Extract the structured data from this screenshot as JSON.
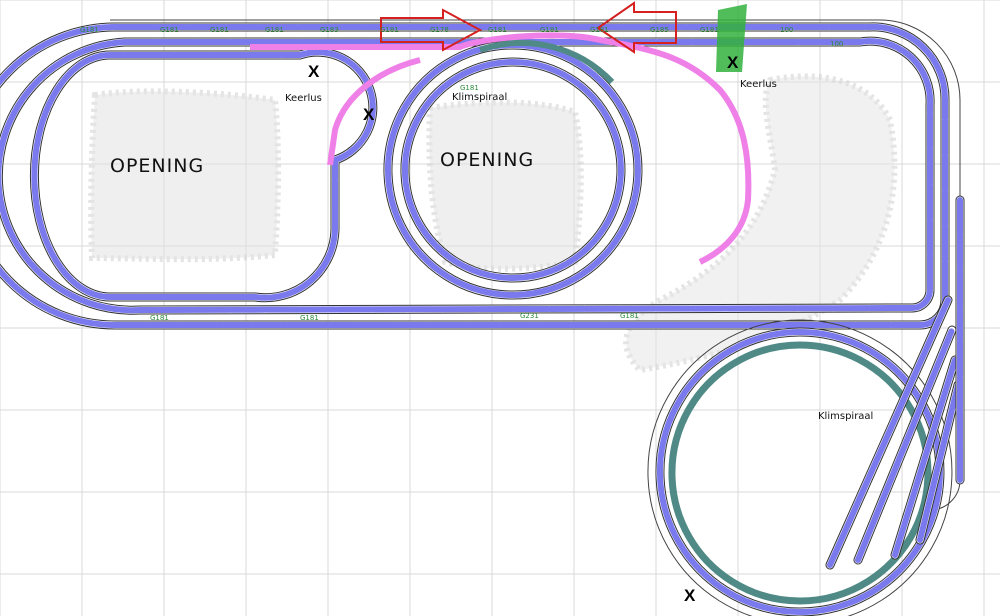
{
  "areas": {
    "opening_left": "OPENING",
    "opening_center": "OPENING",
    "keerlus_left": "Keerlus",
    "keerlus_right": "Keerlus",
    "klimspiraal_top": "Klimspiraal",
    "klimspiraal_right": "Klimspiraal"
  },
  "markers": {
    "x1": "X",
    "x2": "X",
    "x3": "X",
    "x4": "X"
  },
  "track_codes": [
    "G181",
    "G181",
    "G181",
    "G181",
    "G183",
    "G181",
    "G178",
    "G181",
    "G181",
    "G181",
    "G185",
    "G181",
    "G181",
    "G181",
    "G231",
    "G181",
    "G181",
    "100",
    "100"
  ],
  "colors": {
    "track": "#7a7aee",
    "track_edge": "#3b3bb0",
    "highlight": "#ef80e8",
    "spiral": "#4f8a86",
    "grid": "#d8d8d8",
    "arrow": "#d62020",
    "green_block": "#33b23d",
    "code_text": "#2c8a3a"
  }
}
